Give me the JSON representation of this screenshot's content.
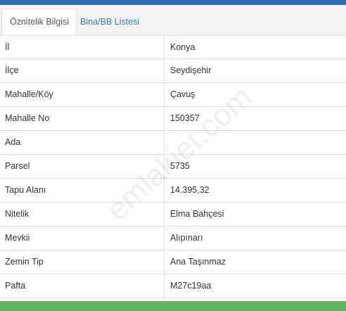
{
  "tabs": [
    {
      "label": "Öznitelik Bilgisi",
      "active": true
    },
    {
      "label": "Bina/BB Listesi",
      "active": false
    }
  ],
  "rows": [
    {
      "key": "İl",
      "value": "Konya"
    },
    {
      "key": "İlçe",
      "value": "Seydişehir"
    },
    {
      "key": "Mahalle/Köy",
      "value": "Çavuş"
    },
    {
      "key": "Mahalle No",
      "value": "150357"
    },
    {
      "key": "Ada",
      "value": ""
    },
    {
      "key": "Parsel",
      "value": "5735"
    },
    {
      "key": "Tapu Alanı",
      "value": "14.395,32"
    },
    {
      "key": "Nitelik",
      "value": "Elma Bahçesi"
    },
    {
      "key": "Mevkii",
      "value": "Alıpınarı"
    },
    {
      "key": "Zemin Tip",
      "value": "Ana Taşınmaz"
    },
    {
      "key": "Pafta",
      "value": "M27c19aa"
    }
  ],
  "watermark": "emlakjet.com",
  "colors": {
    "top_bar": "#2e6db4",
    "link": "#337ab7",
    "bottom_bar": "#5cb85c"
  }
}
